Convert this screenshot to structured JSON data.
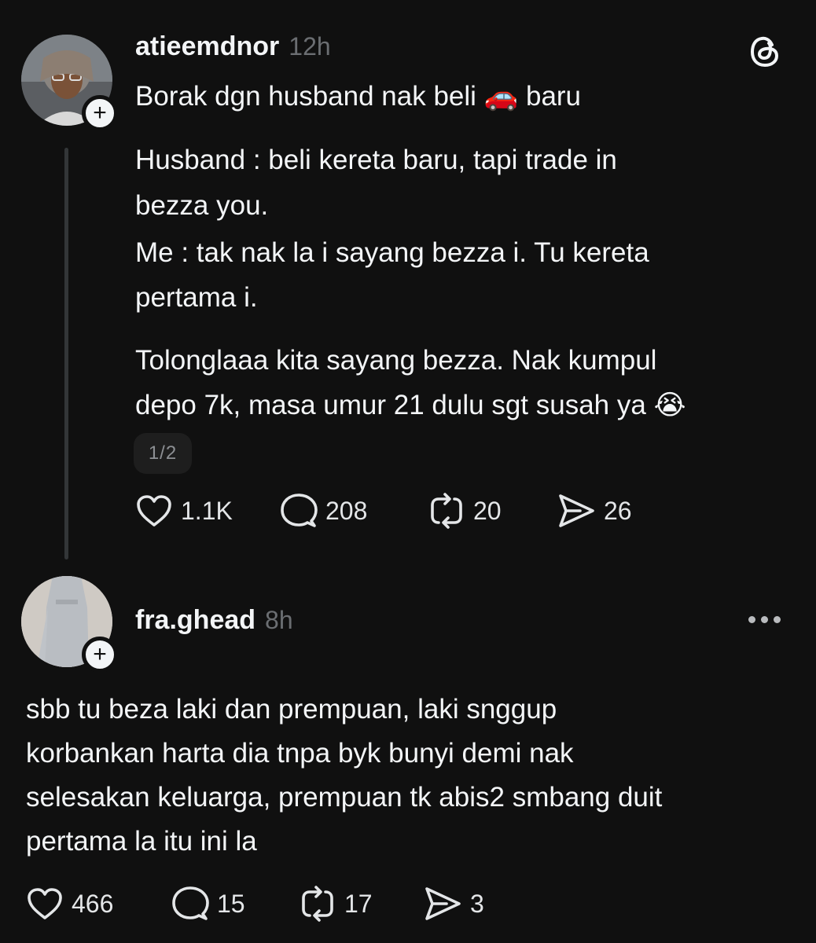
{
  "post": {
    "username": "atieemdnor",
    "time": "12h",
    "lines": [
      "Borak dgn husband nak beli ",
      "Husband : beli kereta baru, tapi trade in",
      "bezza you.",
      "Me : tak nak la i sayang bezza i. Tu kereta",
      "pertama i.",
      "Tolonglaaa kita sayang bezza. Nak kumpul",
      "depo 7k, masa umur 21 dulu sgt susah ya "
    ],
    "line1_emoji": "🚗",
    "line1_after": " baru",
    "last_emoji": "😭",
    "page_indicator": "1/2",
    "likes": "1.1K",
    "comments": "208",
    "reposts": "20",
    "shares": "26"
  },
  "reply": {
    "username": "fra.ghead",
    "time": "8h",
    "lines": [
      "sbb tu beza laki dan prempuan, laki snggup",
      "korbankan harta dia tnpa byk bunyi demi nak",
      "selesakan keluarga, prempuan tk abis2 smbang duit",
      "pertama la itu ini la"
    ],
    "likes": "466",
    "comments": "15",
    "reposts": "17",
    "shares": "3"
  },
  "icons": {
    "logo": "threads-logo-icon",
    "like": "heart-icon",
    "comment": "comment-bubble-icon",
    "repost": "repost-icon",
    "share": "send-icon",
    "follow": "plus-icon",
    "more": "more-dots-icon"
  },
  "colors": {
    "background": "#101010",
    "text": "#f3f5f7",
    "secondary": "#6b6e72",
    "thread_line": "#333638"
  }
}
